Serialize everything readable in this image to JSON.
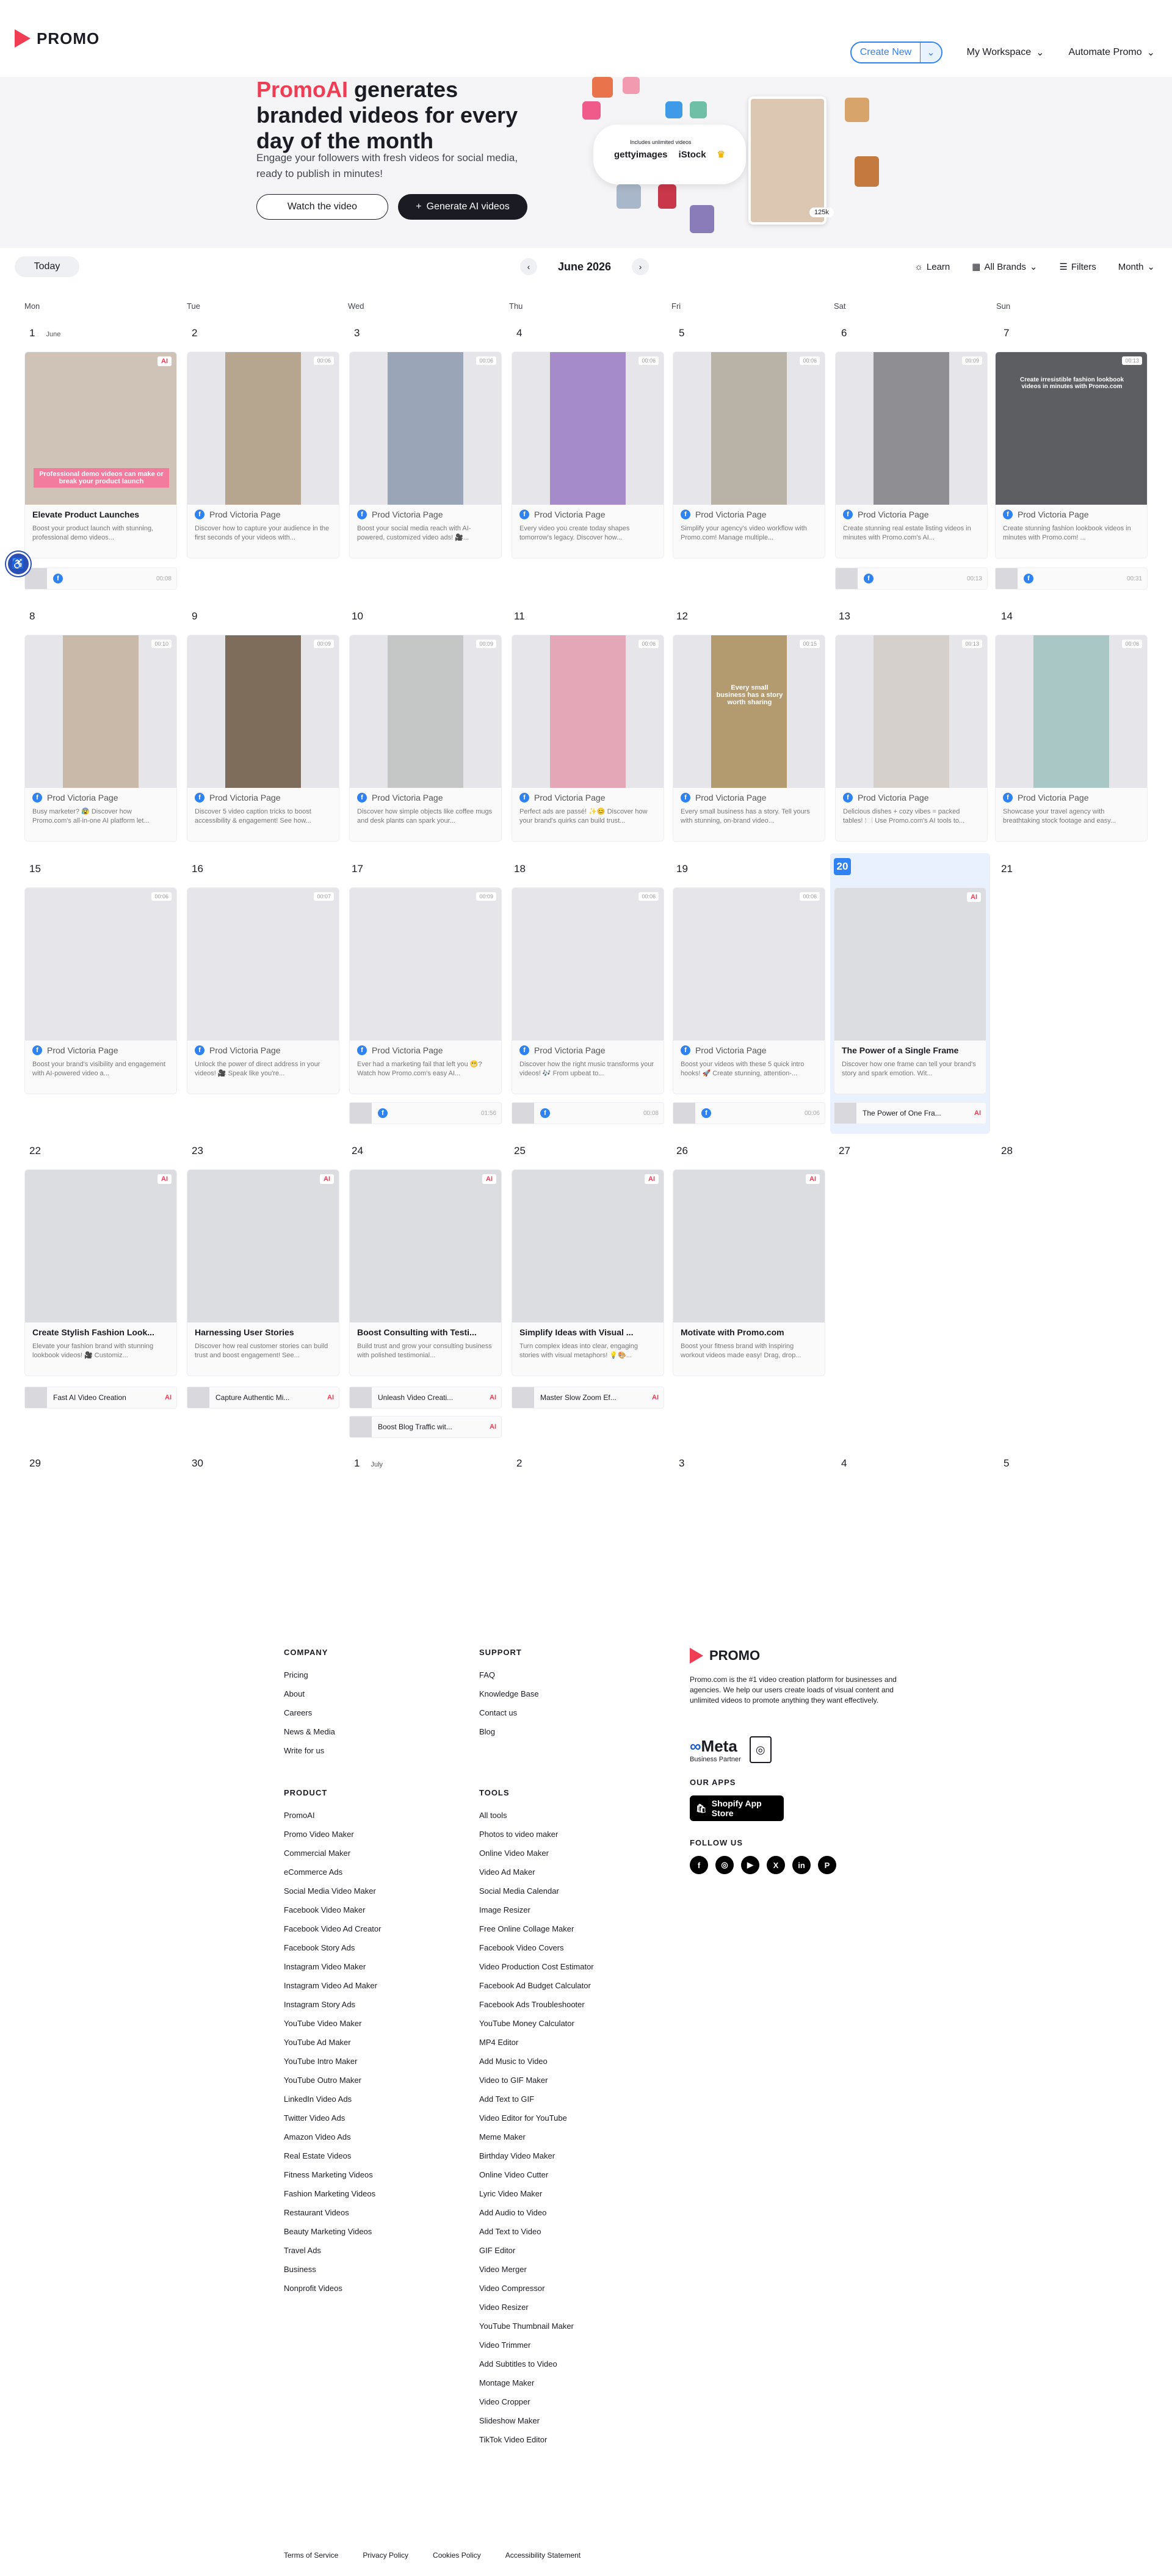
{
  "header": {
    "logo": "PROMO",
    "create_label": "Create New",
    "workspace_label": "My Workspace",
    "automate_label": "Automate Promo"
  },
  "hero": {
    "title_brand": "PromoAI",
    "title_rest": " generates branded videos for every day of the month",
    "subtitle": "Engage your followers with fresh videos for social media, ready to publish in minutes!",
    "watch_label": "Watch the video",
    "generate_label": "Generate AI videos",
    "getty_small": "Includes unlimited videos",
    "getty": "gettyimages",
    "istock": "iStock",
    "likes": "125k"
  },
  "toolbar": {
    "today_label": "Today",
    "month_label": "June 2026",
    "learn_label": "Learn",
    "brands_label": "All Brands",
    "filters_label": "Filters",
    "view_label": "Month"
  },
  "weekdays": [
    "Mon",
    "Tue",
    "Wed",
    "Thu",
    "Fri",
    "Sat",
    "Sun"
  ],
  "weeks": [
    [
      "1",
      "2",
      "3",
      "4",
      "5",
      "6",
      "7"
    ],
    [
      "8",
      "9",
      "10",
      "11",
      "12",
      "13",
      "14"
    ],
    [
      "15",
      "16",
      "17",
      "18",
      "19",
      "20",
      "21"
    ],
    [
      "22",
      "23",
      "24",
      "25",
      "26",
      "27",
      "28"
    ],
    [
      "29",
      "30",
      "1",
      "2",
      "3",
      "4",
      "5"
    ]
  ],
  "month_tags": {
    "june": "June",
    "july": "July"
  },
  "week1": [
    {
      "page": "Elevate Product Launches",
      "desc": "Boost your product launch with stunning, professional demo videos...",
      "badge": "AI",
      "overlay": "Professional demo videos can make or break your product launch"
    },
    {
      "page": "Prod Victoria Page",
      "desc": "Discover how to capture your audience in the first seconds of your videos with...",
      "badge": "00:06"
    },
    {
      "page": "Prod Victoria Page",
      "desc": "Boost your social media reach with AI-powered, customized video ads! 🎥...",
      "badge": "00:06"
    },
    {
      "page": "Prod Victoria Page",
      "desc": "Every video you create today shapes tomorrow's legacy. Discover how...",
      "badge": "00:06"
    },
    {
      "page": "Prod Victoria Page",
      "desc": "Simplify your agency's video workflow with Promo.com! Manage multiple...",
      "badge": "00:06"
    },
    {
      "page": "Prod Victoria Page",
      "desc": "Create stunning real estate listing videos in minutes with Promo.com's AI...",
      "badge": "00:09"
    },
    {
      "page": "Prod Victoria Page",
      "desc": "Create stunning fashion lookbook videos in minutes with Promo.com! ...",
      "badge": "00:13",
      "overlay": "Create irresistible fashion lookbook videos in minutes with Promo.com"
    }
  ],
  "week1_subs": {
    "mon": "00:08",
    "sat": "00:13",
    "sun": "00:31"
  },
  "week2": [
    {
      "page": "Prod Victoria Page",
      "desc": "Busy marketer? 😰 Discover how Promo.com's all-in-one AI platform let...",
      "badge": "00:10"
    },
    {
      "page": "Prod Victoria Page",
      "desc": "Discover 5 video caption tricks to boost accessibility & engagement! See how...",
      "badge": "00:09"
    },
    {
      "page": "Prod Victoria Page",
      "desc": "Discover how simple objects like coffee mugs and desk plants can spark your...",
      "badge": "00:09"
    },
    {
      "page": "Prod Victoria Page",
      "desc": "Perfect ads are passé! ✨😊 Discover how your brand's quirks can build trust...",
      "badge": "00:06"
    },
    {
      "page": "Prod Victoria Page",
      "desc": "Every small business has a story. Tell yours with stunning, on-brand video...",
      "badge": "00:15",
      "overlay": "Every small business has a story worth sharing"
    },
    {
      "page": "Prod Victoria Page",
      "desc": "Delicious dishes + cozy vibes = packed tables! 🍽️ Use Promo.com's AI tools to...",
      "badge": "00:13"
    },
    {
      "page": "Prod Victoria Page",
      "desc": "Showcase your travel agency with breathtaking stock footage and easy...",
      "badge": "00:06"
    }
  ],
  "week3": [
    {
      "page": "Prod Victoria Page",
      "desc": "Boost your brand's visibility and engagement with AI-powered video a...",
      "badge": "00:06"
    },
    {
      "page": "Prod Victoria Page",
      "desc": "Unlock the power of direct address in your videos! 🎥 Speak like you're...",
      "badge": "00:07"
    },
    {
      "page": "Prod Victoria Page",
      "desc": "Ever had a marketing fail that left you 😬? Watch how Promo.com's easy AI...",
      "badge": "00:09"
    },
    {
      "page": "Prod Victoria Page",
      "desc": "Discover how the right music transforms your videos! 🎶 From upbeat to...",
      "badge": "00:06"
    },
    {
      "page": "Prod Victoria Page",
      "desc": "Boost your videos with these 5 quick intro hooks! 🚀 Create stunning, attention-...",
      "badge": "00:06"
    },
    {
      "page": "The Power of a Single Frame",
      "desc": "Discover how one frame can tell your brand's story and spark emotion. Wit...",
      "badge": "AI"
    }
  ],
  "week3_subs": {
    "wed": "01:56",
    "thu": "00:08",
    "fri": "00:06",
    "sat": "The Power of One Fra...",
    "sat_badge": "AI"
  },
  "week4": [
    {
      "title": "Create Stylish Fashion Look...",
      "desc": "Elevate your fashion brand with stunning lookbook videos! 🎥 Customiz...",
      "badge": "AI"
    },
    {
      "title": "Harnessing User Stories",
      "desc": "Discover how real customer stories can build trust and boost engagement! See...",
      "badge": "AI"
    },
    {
      "title": "Boost Consulting with Testi...",
      "desc": "Build trust and grow your consulting business with polished testimonial...",
      "badge": "AI"
    },
    {
      "title": "Simplify Ideas with Visual ...",
      "desc": "Turn complex ideas into clear, engaging stories with visual metaphors! 💡🎨...",
      "badge": "AI"
    },
    {
      "title": "Motivate with Promo.com",
      "desc": "Boost your fitness brand with inspiring workout videos made easy! Drag, drop...",
      "badge": "AI"
    }
  ],
  "week4_subs": [
    {
      "text": "Fast AI Video Creation",
      "badge": "AI"
    },
    {
      "text": "Capture Authentic Mi...",
      "badge": "AI"
    },
    {
      "text": "Unleash Video Creati...",
      "badge": "AI"
    },
    {
      "text": "Master Slow Zoom Ef...",
      "badge": "AI"
    },
    {
      "text": "Boost Blog Traffic wit...",
      "badge": "AI"
    }
  ],
  "footer": {
    "company_title": "COMPANY",
    "company": [
      "Pricing",
      "About",
      "Careers",
      "News & Media",
      "Write for us"
    ],
    "support_title": "SUPPORT",
    "support": [
      "FAQ",
      "Knowledge Base",
      "Contact us",
      "Blog"
    ],
    "product_title": "PRODUCT",
    "product": [
      "PromoAI",
      "Promo Video Maker",
      "Commercial Maker",
      "eCommerce Ads",
      "Social Media Video Maker",
      "Facebook Video Maker",
      "Facebook Video Ad Creator",
      "Facebook Story Ads",
      "Instagram Video Maker",
      "Instagram Video Ad Maker",
      "Instagram Story Ads",
      "YouTube Video Maker",
      "YouTube Ad Maker",
      "YouTube Intro Maker",
      "YouTube Outro Maker",
      "LinkedIn Video Ads",
      "Twitter Video Ads",
      "Amazon Video Ads",
      "Real Estate Videos",
      "Fitness Marketing Videos",
      "Fashion Marketing Videos",
      "Restaurant Videos",
      "Beauty Marketing Videos",
      "Travel Ads",
      "Business",
      "Nonprofit Videos"
    ],
    "tools_title": "TOOLS",
    "tools": [
      "All tools",
      "Photos to video maker",
      "Online Video Maker",
      "Video Ad Maker",
      "Social Media Calendar",
      "Image Resizer",
      "Free Online Collage Maker",
      "Facebook Video Covers",
      "Video Production Cost Estimator",
      "Facebook Ad Budget Calculator",
      "Facebook Ads Troubleshooter",
      "YouTube Money Calculator",
      "MP4 Editor",
      "Add Music to Video",
      "Video to GIF Maker",
      "Add Text to GIF",
      "Video Editor for YouTube",
      "Meme Maker",
      "Birthday Video Maker",
      "Online Video Cutter",
      "Lyric Video Maker",
      "Add Audio to Video",
      "Add Text to Video",
      "GIF Editor",
      "Video Merger",
      "Video Compressor",
      "Video Resizer",
      "YouTube Thumbnail Maker",
      "Video Trimmer",
      "Add Subtitles to Video",
      "Montage Maker",
      "Video Cropper",
      "Slideshow Maker",
      "TikTok Video Editor"
    ],
    "brand": "PROMO",
    "about": "Promo.com is the #1 video creation platform for businesses and agencies. We help our users create loads of visual content and unlimited videos to promote anything they want effectively.",
    "meta": "Meta",
    "meta_sub": "Business Partner",
    "apps_title": "OUR APPS",
    "shopify": "Shopify App Store",
    "follow_title": "FOLLOW US",
    "legal": [
      "Terms of Service",
      "Privacy Policy",
      "Cookies Policy",
      "Accessibility Statement"
    ]
  }
}
